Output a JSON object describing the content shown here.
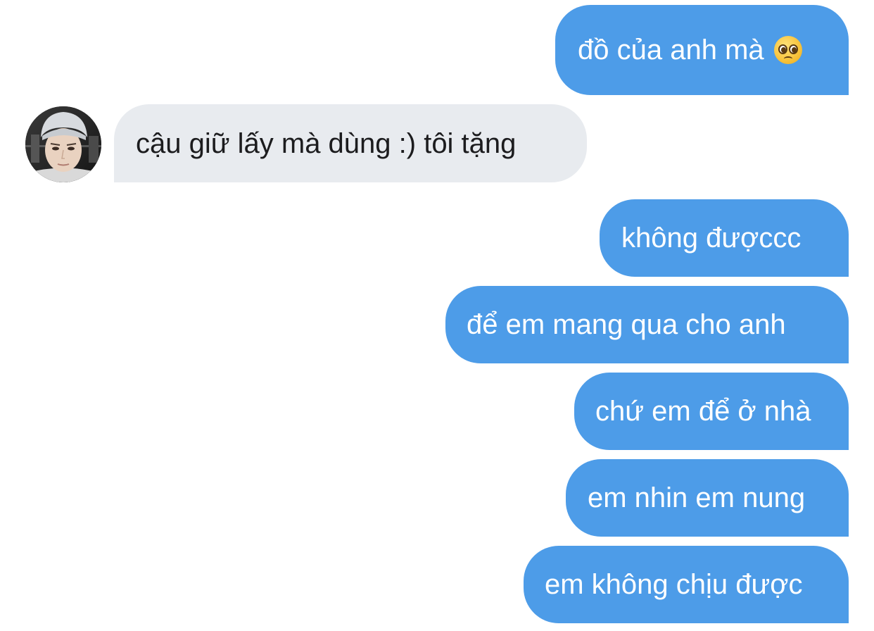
{
  "messages": [
    {
      "from": "me",
      "text": "đồ của anh mà",
      "emoji": "pleading-face"
    },
    {
      "from": "them",
      "text": "cậu giữ lấy mà dùng :) tôi tặng"
    },
    {
      "from": "me",
      "text": "không đượccc"
    },
    {
      "from": "me",
      "text": "để em mang qua cho anh"
    },
    {
      "from": "me",
      "text": "chứ em để ở nhà"
    },
    {
      "from": "me",
      "text": "em nhin em nung"
    },
    {
      "from": "me",
      "text": "em không chịu được"
    }
  ],
  "colors": {
    "sent_bubble": "#4d9ce8",
    "received_bubble": "#e8ebef",
    "background": "#ffffff"
  },
  "avatar": {
    "icon": "profile-photo"
  }
}
